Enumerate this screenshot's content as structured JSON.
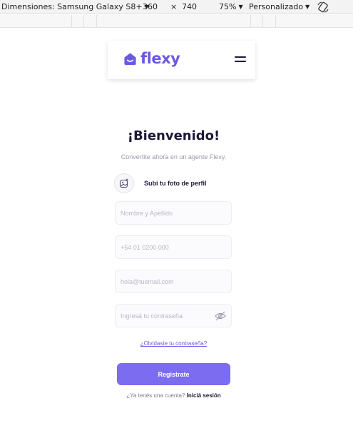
{
  "devtools": {
    "device_label": "Dimensiones: Samsung Galaxy S8+",
    "width": "360",
    "times": "×",
    "height": "740",
    "zoom": "75%",
    "throttle": "Personalizado",
    "caret": "▼",
    "rotate_icon": "rotate-icon"
  },
  "header": {
    "logo_text": "flexy",
    "brand_color": "#6a5ae0",
    "menu_icon": "hamburger-menu-icon"
  },
  "form": {
    "title": "¡Bienvenido!",
    "subtitle": "Convertite ahora en un agente Flexy.",
    "photo_label": "Subí tu foto de perfil",
    "photo_icon": "add-photo-icon",
    "name_placeholder": "Nombre y Apellido",
    "phone_placeholder": "+54 01 0200 000",
    "email_placeholder": "hola@tuemail.com",
    "password_placeholder": "Ingresá tu contraseña",
    "password_toggle_icon": "eye-off-icon",
    "forgot_link": "¿Olvidaste tu contraseña?",
    "register_button": "Registrate",
    "register_color": "#7b6cf0",
    "have_account_text": "¿Ya tenés una cuenta? ",
    "login_link": "Iniciá sesión"
  }
}
